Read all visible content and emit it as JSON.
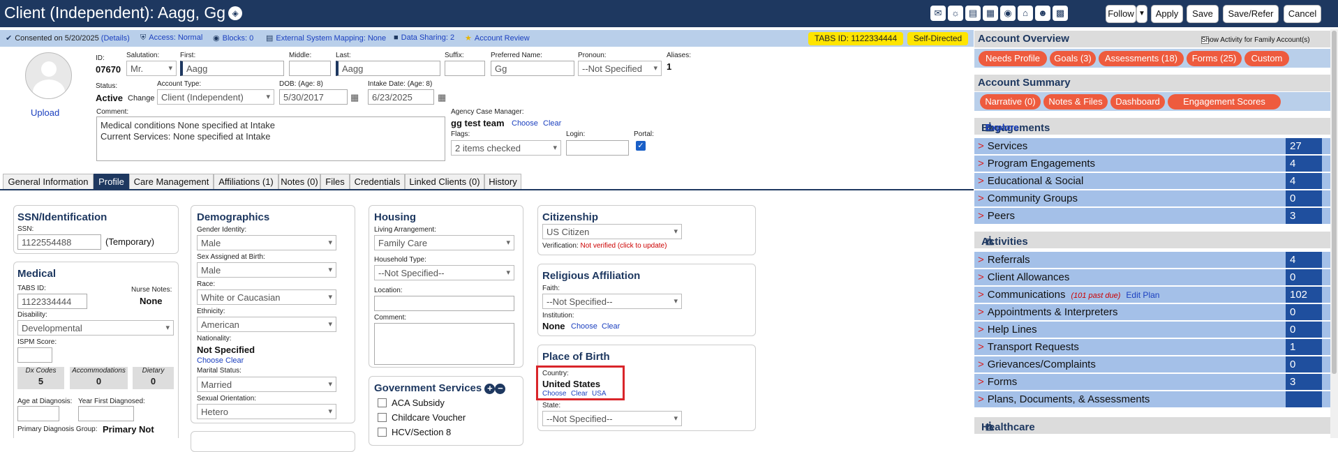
{
  "title": "Client (Independent): Aagg, Gg",
  "toolbar": {
    "follow": "Follow",
    "apply": "Apply",
    "save": "Save",
    "save_refer": "Save/Refer",
    "cancel": "Cancel"
  },
  "infobar": {
    "consent": "Consented on 5/20/2025",
    "details": "(Details)",
    "access": "Access: Normal",
    "blocks": "Blocks: 0",
    "mapping": "External System Mapping: None",
    "sharing": "Data Sharing: 2",
    "review": "Account Review",
    "tabs_id": "TABS ID: 1122334444",
    "self_directed": "Self-Directed"
  },
  "client": {
    "upload": "Upload",
    "id_label": "ID:",
    "id": "07670",
    "salutation_label": "Salutation:",
    "salutation": "Mr.",
    "first_label": "First:",
    "first": "Aagg",
    "middle_label": "Middle:",
    "middle": "",
    "last_label": "Last:",
    "last": "Aagg",
    "suffix_label": "Suffix:",
    "suffix": "",
    "preferred_label": "Preferred Name:",
    "preferred": "Gg",
    "pronoun_label": "Pronoun:",
    "pronoun": "--Not Specified",
    "aliases_label": "Aliases:",
    "aliases": "1",
    "status_label": "Status:",
    "status": "Active",
    "change": "Change",
    "account_type_label": "Account Type:",
    "account_type": "Client (Independent)",
    "dob_label": "DOB: (Age: 8)",
    "dob": "5/30/2017",
    "intake_label": "Intake Date: (Age: 8)",
    "intake": "6/23/2025",
    "comment_label": "Comment:",
    "comment_line1": "Medical conditions None specified at Intake",
    "comment_line2": "Current Services: None specified at Intake",
    "case_manager_label": "Agency Case Manager:",
    "case_manager": "gg test team",
    "choose": "Choose",
    "clear": "Clear",
    "flags_label": "Flags:",
    "flags": "2 items checked",
    "login_label": "Login:",
    "login": "",
    "portal_label": "Portal:"
  },
  "tabs": [
    "General Information",
    "Profile",
    "Care Management",
    "Affiliations (1)",
    "Notes (0)",
    "Files",
    "Credentials",
    "Linked Clients (0)",
    "History"
  ],
  "ssn": {
    "title": "SSN/Identification",
    "label": "SSN:",
    "value": "1122554488",
    "note": "(Temporary)"
  },
  "medical": {
    "title": "Medical",
    "tabs_label": "TABS ID:",
    "tabs_id": "1122334444",
    "nurse_label": "Nurse Notes:",
    "nurse": "None",
    "disability_label": "Disability:",
    "disability": "Developmental",
    "ispm_label": "ISPM Score:",
    "dx_label": "Dx Codes",
    "dx": "5",
    "acc_label": "Accommodations",
    "acc": "0",
    "diet_label": "Dietary",
    "diet": "0",
    "age_diag_label": "Age at Diagnosis:",
    "year_diag_label": "Year First Diagnosed:",
    "primary_label": "Primary Diagnosis Group:",
    "primary": "Primary Not"
  },
  "demographics": {
    "title": "Demographics",
    "gender_label": "Gender Identity:",
    "gender": "Male",
    "sex_label": "Sex Assigned at Birth:",
    "sex": "Male",
    "race_label": "Race:",
    "race": "White or Caucasian",
    "ethnicity_label": "Ethnicity:",
    "ethnicity": "American",
    "nationality_label": "Nationality:",
    "nationality": "Not Specified",
    "choose": "Choose",
    "clear": "Clear",
    "marital_label": "Marital Status:",
    "marital": "Married",
    "orientation_label": "Sexual Orientation:",
    "orientation": "Hetero"
  },
  "housing": {
    "title": "Housing",
    "living_label": "Living Arrangement:",
    "living": "Family Care",
    "household_label": "Household Type:",
    "household": "--Not Specified--",
    "location_label": "Location:",
    "comment_label": "Comment:"
  },
  "gov": {
    "title": "Government Services",
    "items": [
      "ACA Subsidy",
      "Childcare Voucher",
      "HCV/Section 8"
    ]
  },
  "citizenship": {
    "title": "Citizenship",
    "value": "US Citizen",
    "verification_label": "Verification:",
    "verification": "Not verified (click to update)"
  },
  "religion": {
    "title": "Religious Affiliation",
    "faith_label": "Faith:",
    "faith": "--Not Specified--",
    "institution_label": "Institution:",
    "institution": "None",
    "choose": "Choose",
    "clear": "Clear"
  },
  "birth": {
    "title": "Place of Birth",
    "country_label": "Country:",
    "country": "United States",
    "choose": "Choose",
    "clear": "Clear",
    "usa": "USA",
    "state_label": "State:",
    "state": "--Not Specified--"
  },
  "right": {
    "overview_title": "Account Overview",
    "show_activity": "Show Activity for Family Account(s)",
    "overview_pills": [
      "Needs Profile",
      "Goals (3)",
      "Assessments (18)",
      "Forms (25)",
      "Custom"
    ],
    "summary_title": "Account Summary",
    "summary_pills": [
      "Narrative (0)",
      "Notes & Files",
      "Dashboard",
      "Engagement Scores"
    ],
    "engagements_title": "Engagements",
    "explore": "Explore",
    "engagements": [
      {
        "name": "Services",
        "count": "27"
      },
      {
        "name": "Program Engagements",
        "count": "4"
      },
      {
        "name": "Educational & Social",
        "count": "4"
      },
      {
        "name": "Community Groups",
        "count": "0"
      },
      {
        "name": "Peers",
        "count": "3"
      }
    ],
    "activities_title": "Activities",
    "activities": [
      {
        "name": "Referrals",
        "count": "4"
      },
      {
        "name": "Client Allowances",
        "count": "0"
      },
      {
        "name": "Communications",
        "count": "102",
        "note": "(101 past due)",
        "edit": "Edit Plan"
      },
      {
        "name": "Appointments & Interpreters",
        "count": "0"
      },
      {
        "name": "Help Lines",
        "count": "0"
      },
      {
        "name": "Transport Requests",
        "count": "1"
      },
      {
        "name": "Grievances/Complaints",
        "count": "0"
      },
      {
        "name": "Forms",
        "count": "3"
      },
      {
        "name": "Plans, Documents, & Assessments",
        "count": ""
      }
    ],
    "healthcare_title": "Healthcare"
  }
}
